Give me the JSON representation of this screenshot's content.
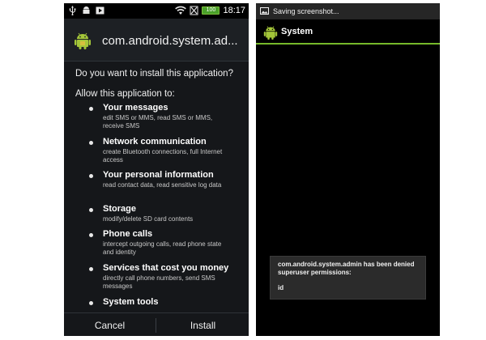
{
  "left_screen": {
    "status_bar": {
      "time": "18:17",
      "battery_label": "100"
    },
    "header": {
      "package_name": "com.android.system.ad..."
    },
    "question": "Do you want to install this application?",
    "allow_heading": "Allow this application to:",
    "permissions": [
      {
        "title": "Your messages",
        "description": "edit SMS or MMS, read SMS or MMS, receive SMS"
      },
      {
        "title": "Network communication",
        "description": "create Bluetooth connections, full Internet access"
      },
      {
        "title": "Your personal information",
        "description": "read contact data, read sensitive log data"
      },
      {
        "title": "Storage",
        "description": "modify/delete SD card contents"
      },
      {
        "title": "Phone calls",
        "description": "intercept outgoing calls, read phone state and identity"
      },
      {
        "title": "Services that cost you money",
        "description": "directly call phone numbers, send SMS messages"
      },
      {
        "title": "System tools",
        "description": ""
      }
    ],
    "buttons": {
      "cancel": "Cancel",
      "install": "Install"
    }
  },
  "right_screen": {
    "status_text": "Saving screenshot...",
    "header_title": "System",
    "toast": {
      "message": "com.android.system.admin has been denied superuser permissions:",
      "detail": "id"
    }
  },
  "colors": {
    "accent_green": "#76b82a",
    "android_green": "#a4c639",
    "dark_background": "#15171a"
  }
}
